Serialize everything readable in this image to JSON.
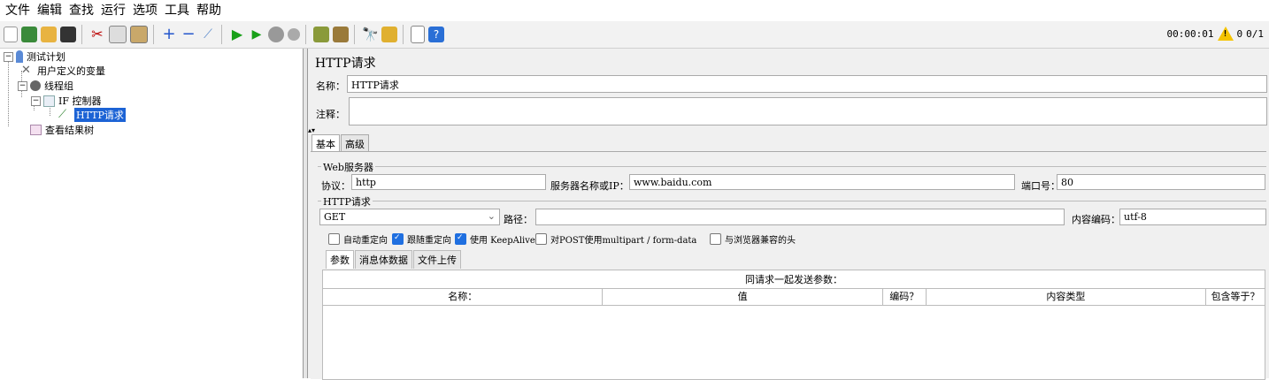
{
  "menu": [
    "文件",
    "编辑",
    "查找",
    "运行",
    "选项",
    "工具",
    "帮助"
  ],
  "toolbar": {
    "icons": [
      "new-icon",
      "templates-icon",
      "open-icon",
      "save-icon",
      "cut-icon",
      "copy-icon",
      "paste-icon",
      "expand-icon",
      "collapse-icon",
      "toggle-icon",
      "start-icon",
      "start-no-pause-icon",
      "stop-icon",
      "shutdown-icon",
      "clear-icon",
      "clear-all-icon",
      "search-icon",
      "reset-search-icon",
      "function-helper-icon",
      "help-icon"
    ],
    "timer": "00:00:01",
    "warning_count": "0",
    "threads": "0/1"
  },
  "tree": {
    "items": [
      {
        "label": "测试计划"
      },
      {
        "label": "用户定义的变量"
      },
      {
        "label": "线程组"
      },
      {
        "label": "IF 控制器"
      },
      {
        "label": "HTTP请求"
      },
      {
        "label": "查看结果树"
      }
    ]
  },
  "main": {
    "title": "HTTP请求",
    "name_label": "名称：",
    "name_value": "HTTP请求",
    "comment_label": "注释：",
    "comment_value": "",
    "tabs": [
      "基本",
      "高级"
    ],
    "web_server": {
      "legend": "Web服务器",
      "protocol_label": "协议：",
      "protocol_value": "http",
      "server_label": "服务器名称或IP：",
      "server_value": "www.baidu.com",
      "port_label": "端口号：",
      "port_value": "80"
    },
    "http_request": {
      "legend": "HTTP请求",
      "method_value": "GET",
      "path_label": "路径：",
      "path_value": "",
      "encoding_label": "内容编码：",
      "encoding_value": "utf-8"
    },
    "checkboxes": [
      {
        "label": "自动重定向",
        "checked": false
      },
      {
        "label": "跟随重定向",
        "checked": true
      },
      {
        "label": "使用 KeepAlive",
        "checked": true
      },
      {
        "label": "对POST使用multipart / form-data",
        "checked": false
      },
      {
        "label": "与浏览器兼容的头",
        "checked": false
      }
    ],
    "subtabs": [
      "参数",
      "消息体数据",
      "文件上传"
    ],
    "table": {
      "caption": "同请求一起发送参数：",
      "columns": [
        "名称：",
        "值",
        "编码？",
        "内容类型",
        "包含等于？"
      ]
    }
  }
}
